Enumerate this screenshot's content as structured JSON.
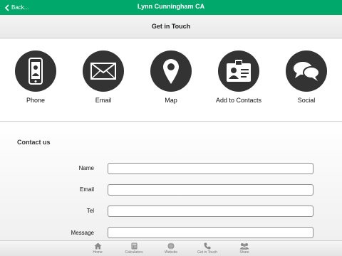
{
  "topbar": {
    "back_label": "Back...",
    "title": "Lynn Cunningham CA"
  },
  "subheader": {
    "title": "Get in Touch"
  },
  "actions": [
    {
      "label": "Phone",
      "icon": "phone-icon"
    },
    {
      "label": "Email",
      "icon": "envelope-icon"
    },
    {
      "label": "Map",
      "icon": "map-pin-icon"
    },
    {
      "label": "Add to Contacts",
      "icon": "contact-card-icon"
    },
    {
      "label": "Social",
      "icon": "chat-bubbles-icon"
    }
  ],
  "contact_form": {
    "heading": "Contact us",
    "fields": [
      {
        "label": "Name",
        "value": ""
      },
      {
        "label": "Email",
        "value": ""
      },
      {
        "label": "Tel",
        "value": ""
      },
      {
        "label": "Message",
        "value": ""
      }
    ]
  },
  "tabbar": {
    "tabs": [
      {
        "label": "Home",
        "icon": "home-icon"
      },
      {
        "label": "Calculators",
        "icon": "calculator-icon"
      },
      {
        "label": "Website",
        "icon": "globe-icon"
      },
      {
        "label": "Get in Touch",
        "icon": "phone-handset-icon"
      },
      {
        "label": "Share",
        "icon": "people-icon"
      }
    ]
  },
  "colors": {
    "brand": "#00a86b",
    "icon_circle": "#333333"
  }
}
